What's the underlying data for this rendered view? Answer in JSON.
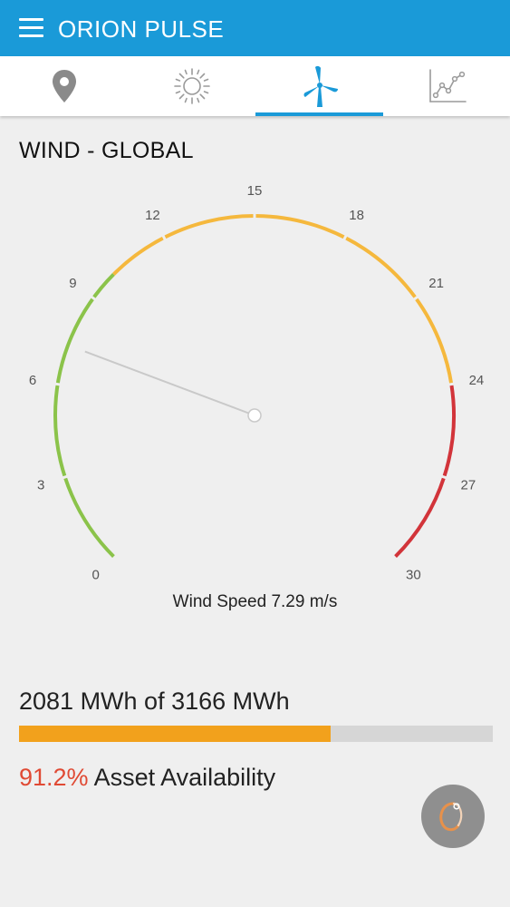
{
  "app": {
    "title": "ORION PULSE",
    "menu_icon": "hamburger-menu-icon",
    "brand_color": "#1a9ad8"
  },
  "tabs": [
    {
      "icon": "location-pin-icon",
      "selected": false
    },
    {
      "icon": "sun-icon",
      "selected": false
    },
    {
      "icon": "wind-turbine-icon",
      "selected": true
    },
    {
      "icon": "line-chart-icon",
      "selected": false
    }
  ],
  "section": {
    "title": "WIND - GLOBAL"
  },
  "gauge": {
    "min": 0,
    "max": 30,
    "value": 7.29,
    "tick_labels": [
      "0",
      "3",
      "6",
      "9",
      "12",
      "15",
      "18",
      "21",
      "24",
      "27",
      "30"
    ],
    "bands": [
      {
        "from": 0,
        "to": 10,
        "color": "#8bc34a"
      },
      {
        "from": 10,
        "to": 24,
        "color": "#f5b83d"
      },
      {
        "from": 24,
        "to": 30,
        "color": "#d2343a"
      }
    ],
    "caption": "Wind Speed 7.29 m/s"
  },
  "energy": {
    "text": "2081 MWh of 3166 MWh",
    "produced": 2081,
    "target": 3166,
    "bar_color": "#f2a11c"
  },
  "availability": {
    "percent_text": "91.2%",
    "label": "Asset Availability",
    "percent_color": "#e04a34"
  },
  "fab": {
    "icon": "refresh-spinner-icon"
  }
}
